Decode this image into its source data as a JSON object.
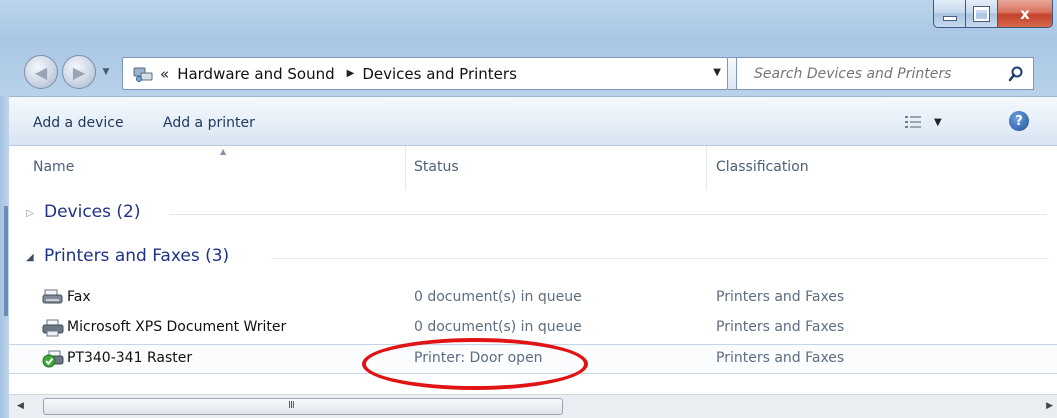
{
  "window": {
    "minimize_label": "",
    "maximize_label": "",
    "close_label": "x"
  },
  "address_bar": {
    "overflow_chevron": "«",
    "breadcrumbs": [
      "Hardware and Sound",
      "Devices and Printers"
    ],
    "icon": "devices-printers-icon"
  },
  "search": {
    "placeholder": "Search Devices and Printers"
  },
  "toolbar": {
    "add_device_label": "Add a device",
    "add_printer_label": "Add a printer",
    "help_label": "?"
  },
  "columns": [
    "Name",
    "Status",
    "Classification"
  ],
  "groups": [
    {
      "title": "Devices (2)",
      "expanded": false
    },
    {
      "title": "Printers and Faxes (3)",
      "expanded": true
    }
  ],
  "printers": [
    {
      "name": "Fax",
      "status": "0 document(s) in queue",
      "classification": "Printers and Faxes",
      "icon": "fax-icon"
    },
    {
      "name": "Microsoft XPS Document Writer",
      "status": "0 document(s) in queue",
      "classification": "Printers and Faxes",
      "icon": "printer-icon"
    },
    {
      "name": "PT340-341 Raster",
      "status": "Printer:  Door open",
      "classification": "Printers and Faxes",
      "icon": "default-printer-icon"
    }
  ],
  "scrollbar": {
    "grip": "III"
  },
  "colors": {
    "annotation": "#e01414",
    "group_title": "#1e3287",
    "toolbar_text": "#1e395b"
  }
}
